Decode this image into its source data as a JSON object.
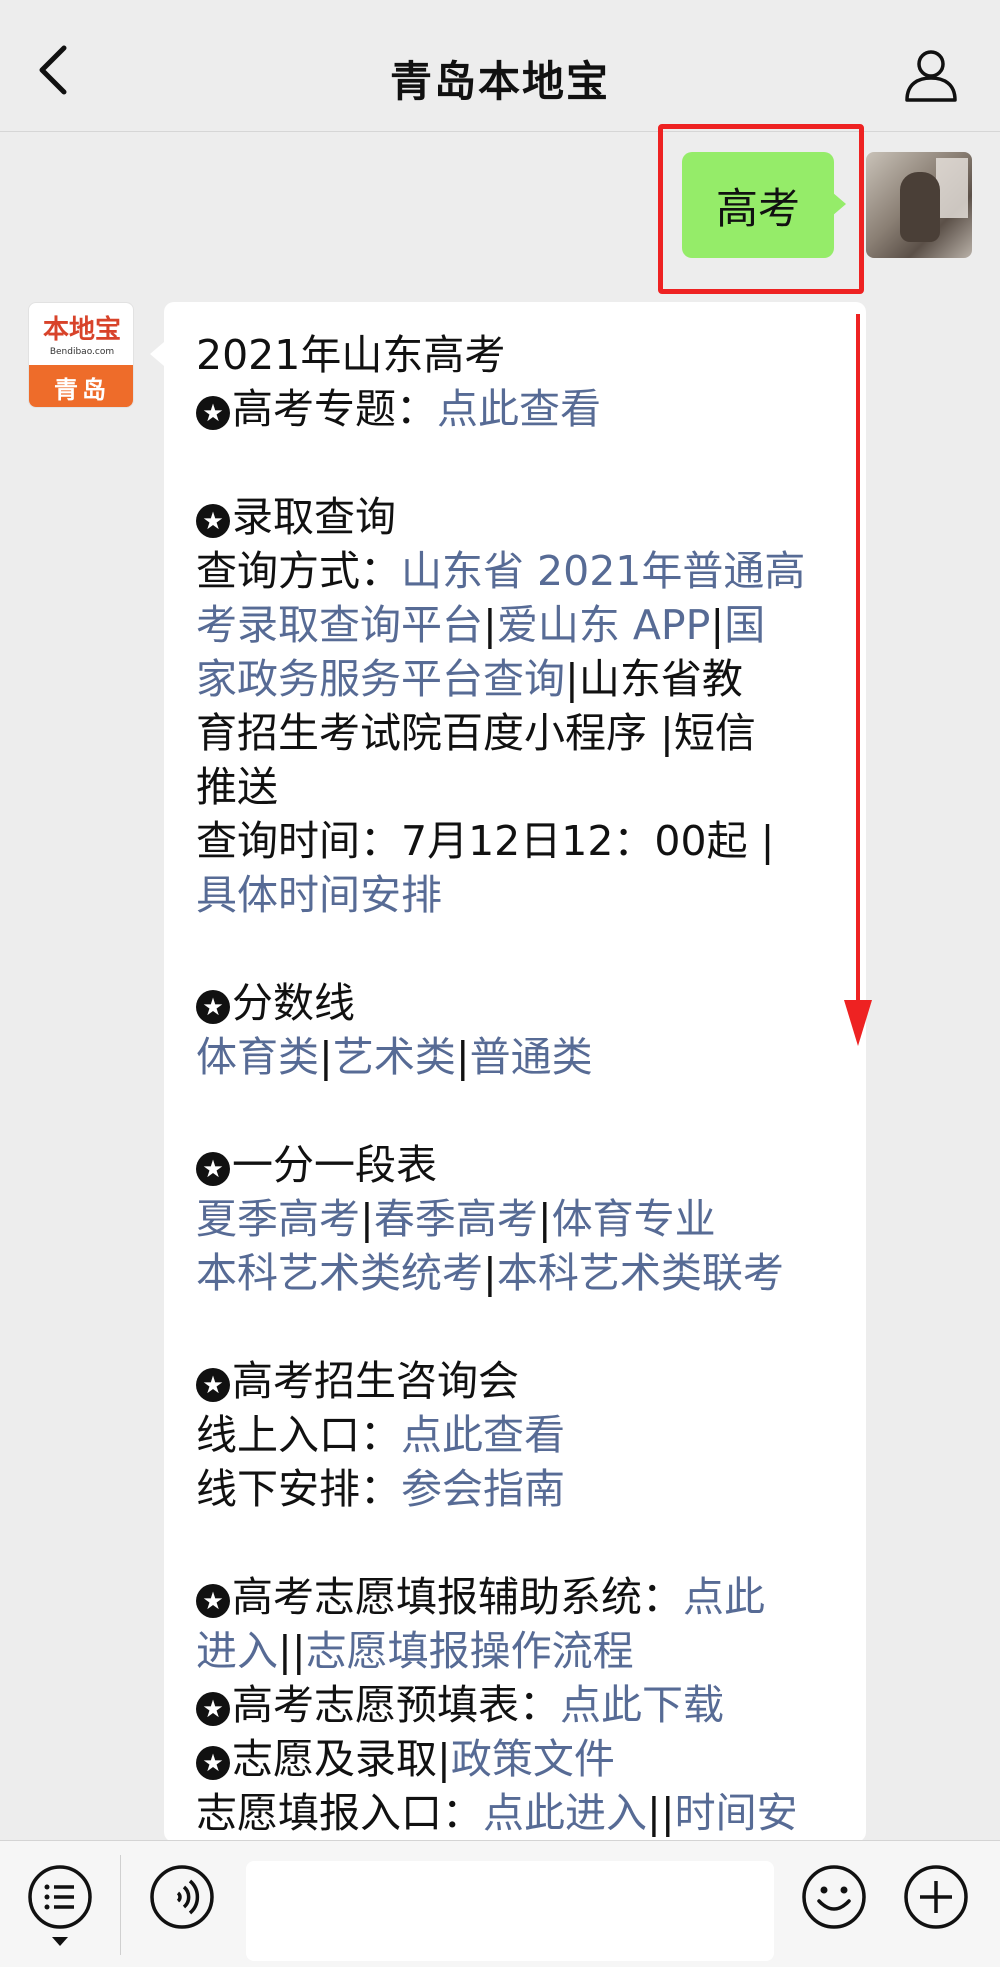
{
  "header": {
    "title": "青岛本地宝"
  },
  "sent": {
    "text": "高考"
  },
  "logo": {
    "brand": "本地宝",
    "url": "Bendibao.com",
    "city": "青岛"
  },
  "message": {
    "lines": [
      [
        {
          "t": "2021年山东高考"
        }
      ],
      [
        {
          "star": true
        },
        {
          "t": "高考专题："
        },
        {
          "t": "点此查看",
          "link": true
        }
      ],
      [],
      [
        {
          "star": true
        },
        {
          "t": "录取查询"
        }
      ],
      [
        {
          "t": "查询方式："
        },
        {
          "t": "山东省 2021年普通高",
          "link": true
        }
      ],
      [
        {
          "t": "考录取查询平台",
          "link": true
        },
        {
          "t": "|"
        },
        {
          "t": "爱山东 APP",
          "link": true
        },
        {
          "t": "|"
        },
        {
          "t": "国",
          "link": true
        }
      ],
      [
        {
          "t": "家政务服务平台查询",
          "link": true
        },
        {
          "t": "|山东省教"
        }
      ],
      [
        {
          "t": "育招生考试院百度小程序 |短信"
        }
      ],
      [
        {
          "t": "推送"
        }
      ],
      [
        {
          "t": "查询时间：7月12日12：00起 |"
        }
      ],
      [
        {
          "t": "具体时间安排",
          "link": true
        }
      ],
      [],
      [
        {
          "star": true
        },
        {
          "t": "分数线"
        }
      ],
      [
        {
          "t": "体育类",
          "link": true
        },
        {
          "t": "|"
        },
        {
          "t": "艺术类",
          "link": true
        },
        {
          "t": "|"
        },
        {
          "t": "普通类",
          "link": true
        }
      ],
      [],
      [
        {
          "star": true
        },
        {
          "t": "一分一段表"
        }
      ],
      [
        {
          "t": "夏季高考",
          "link": true
        },
        {
          "t": "|"
        },
        {
          "t": "春季高考",
          "link": true
        },
        {
          "t": "|"
        },
        {
          "t": "体育专业",
          "link": true
        }
      ],
      [
        {
          "t": "本科艺术类统考",
          "link": true
        },
        {
          "t": "|"
        },
        {
          "t": "本科艺术类联考",
          "link": true
        }
      ],
      [],
      [
        {
          "star": true
        },
        {
          "t": "高考招生咨询会"
        }
      ],
      [
        {
          "t": "线上入口："
        },
        {
          "t": "点此查看",
          "link": true
        }
      ],
      [
        {
          "t": "线下安排："
        },
        {
          "t": "参会指南",
          "link": true
        }
      ],
      [],
      [
        {
          "star": true
        },
        {
          "t": "高考志愿填报辅助系统："
        },
        {
          "t": "点此",
          "link": true
        }
      ],
      [
        {
          "t": "进入",
          "link": true
        },
        {
          "t": "||"
        },
        {
          "t": "志愿填报操作流程",
          "link": true
        }
      ],
      [
        {
          "star": true
        },
        {
          "t": "高考志愿预填表："
        },
        {
          "t": "点此下载",
          "link": true
        }
      ],
      [
        {
          "star": true
        },
        {
          "t": "志愿及录取"
        },
        {
          "t": "|"
        },
        {
          "t": "政策文件",
          "link": true
        }
      ],
      [
        {
          "t": "志愿填报入口："
        },
        {
          "t": "点此进入",
          "link": true
        },
        {
          "t": "||"
        },
        {
          "t": "时间安",
          "link": true
        }
      ]
    ]
  },
  "colors": {
    "link": "#576b95",
    "sent_bubble": "#95ec69",
    "highlight": "#ee2222",
    "star_glyph": "★"
  },
  "icons": {
    "back": "chevron-left-icon",
    "profile": "person-icon",
    "menu": "list-menu-icon",
    "voice": "voice-icon",
    "emoji": "smiley-icon",
    "add": "plus-circle-icon"
  }
}
